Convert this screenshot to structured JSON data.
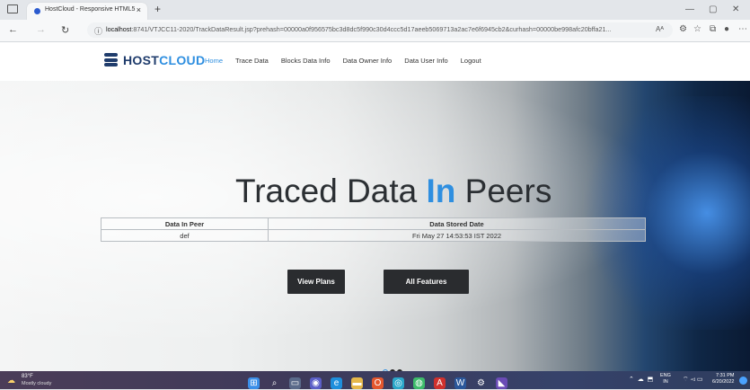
{
  "browser": {
    "tab_title": "HostCloud - Responsive HTML5",
    "tab_close": "×",
    "new_tab": "+",
    "url_host": "localhost",
    "url_rest": ":8741/VTJCC11-2020/TrackDataResult.jsp?prehash=00000a0f956575bc3d8dc5f990c30d4ccc5d17aeeb5069713a2ac7e6f6945cb2&curhash=00000be998afc20bffa21...",
    "read_aloud": "Aᴬ"
  },
  "site": {
    "logo_host": "HOST",
    "logo_cloud": "CLOUD",
    "nav": [
      "Home",
      "Trace Data",
      "Blocks Data Info",
      "Data Owner Info",
      "Data User Info",
      "Logout"
    ]
  },
  "hero": {
    "title_part1": "Traced Data ",
    "title_highlight": "In",
    "title_part2": " Peers"
  },
  "results_table": {
    "headers": [
      "Data In Peer",
      "Data Stored Date"
    ],
    "rows": [
      [
        "def",
        "Fri May 27 14:53:53 IST 2022"
      ]
    ]
  },
  "buttons": {
    "view_plans": "View Plans",
    "all_features": "All Features"
  },
  "taskbar": {
    "temperature": "83°F",
    "weather": "Mostly cloudy",
    "lang_line1": "ENG",
    "lang_line2": "IN",
    "time": "7:31 PM",
    "date": "6/20/2022"
  },
  "colors": {
    "brand_dark": "#1f3c6c",
    "accent": "#2f8fe0",
    "button_bg": "#2a2c2f"
  }
}
